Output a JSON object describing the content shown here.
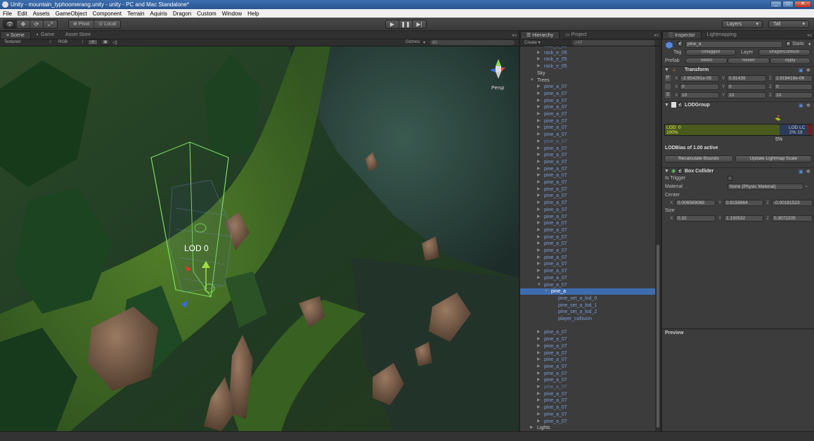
{
  "window": {
    "title": "Unity - mountain_typhoomerang.unity - unity - PC and Mac Standalone*"
  },
  "menu": [
    "File",
    "Edit",
    "Assets",
    "GameObject",
    "Component",
    "Terrain",
    "Aquiris",
    "Dragon",
    "Custom",
    "Window",
    "Help"
  ],
  "toolbar": {
    "pivot": "Pivot",
    "local": "Local",
    "layers": "Layers",
    "layout": "Tall"
  },
  "scene": {
    "tabs": [
      "Scene",
      "Game",
      "Asset Store"
    ],
    "render_mode": "Textured",
    "color_mode": "RGB",
    "gizmos": "Gizmos",
    "search": "All",
    "lod_label": "LOD 0",
    "persp": "Persp"
  },
  "hierarchy": {
    "tabs": [
      "Hierarchy",
      "Project"
    ],
    "create": "Create",
    "search": "All",
    "rows": [
      {
        "name": "rock_e_05",
        "indent": 1,
        "arrow": "▶",
        "style": "prefab"
      },
      {
        "name": "rock_e_05",
        "indent": 1,
        "arrow": "▶",
        "style": "prefab"
      },
      {
        "name": "rock_e_05",
        "indent": 1,
        "arrow": "▶",
        "style": "prefab"
      },
      {
        "name": "rock_e_05",
        "indent": 1,
        "arrow": "▶",
        "style": "prefab"
      },
      {
        "name": "Sky",
        "indent": 0,
        "arrow": "",
        "style": "plain"
      },
      {
        "name": "Trees",
        "indent": 0,
        "arrow": "▼",
        "style": "plain"
      },
      {
        "name": "pine_a_07",
        "indent": 1,
        "arrow": "▶",
        "style": "prefab"
      },
      {
        "name": "pine_a_07",
        "indent": 1,
        "arrow": "▶",
        "style": "prefab"
      },
      {
        "name": "pine_a_07",
        "indent": 1,
        "arrow": "▶",
        "style": "prefab"
      },
      {
        "name": "pine_a_07",
        "indent": 1,
        "arrow": "▶",
        "style": "prefab"
      },
      {
        "name": "pine_a_07",
        "indent": 1,
        "arrow": "▶",
        "style": "prefab"
      },
      {
        "name": "pine_a_07",
        "indent": 1,
        "arrow": "▶",
        "style": "prefab"
      },
      {
        "name": "pine_a_07",
        "indent": 1,
        "arrow": "▶",
        "style": "prefab"
      },
      {
        "name": "pine_a_07",
        "indent": 1,
        "arrow": "▶",
        "style": "prefab"
      },
      {
        "name": "pine_a_07",
        "indent": 1,
        "arrow": "▶",
        "style": "dim"
      },
      {
        "name": "pine_a_07",
        "indent": 1,
        "arrow": "▶",
        "style": "prefab"
      },
      {
        "name": "pine_a_07",
        "indent": 1,
        "arrow": "▶",
        "style": "prefab"
      },
      {
        "name": "pine_a_07",
        "indent": 1,
        "arrow": "▶",
        "style": "prefab"
      },
      {
        "name": "pine_a_07",
        "indent": 1,
        "arrow": "▶",
        "style": "prefab"
      },
      {
        "name": "pine_a_07",
        "indent": 1,
        "arrow": "▶",
        "style": "prefab"
      },
      {
        "name": "pine_a_07",
        "indent": 1,
        "arrow": "▶",
        "style": "prefab"
      },
      {
        "name": "pine_a_07",
        "indent": 1,
        "arrow": "▶",
        "style": "prefab"
      },
      {
        "name": "pine_a_07",
        "indent": 1,
        "arrow": "▶",
        "style": "prefab"
      },
      {
        "name": "pine_a_07",
        "indent": 1,
        "arrow": "▶",
        "style": "prefab"
      },
      {
        "name": "pine_a_07",
        "indent": 1,
        "arrow": "▶",
        "style": "prefab"
      },
      {
        "name": "pine_a_07",
        "indent": 1,
        "arrow": "▶",
        "style": "prefab"
      },
      {
        "name": "pine_a_07",
        "indent": 1,
        "arrow": "▶",
        "style": "prefab"
      },
      {
        "name": "pine_a_07",
        "indent": 1,
        "arrow": "▶",
        "style": "prefab"
      },
      {
        "name": "pine_a_07",
        "indent": 1,
        "arrow": "▶",
        "style": "prefab"
      },
      {
        "name": "pine_a_07",
        "indent": 1,
        "arrow": "▶",
        "style": "prefab"
      },
      {
        "name": "pine_a_07",
        "indent": 1,
        "arrow": "▶",
        "style": "prefab"
      },
      {
        "name": "pine_a_07",
        "indent": 1,
        "arrow": "▶",
        "style": "prefab"
      },
      {
        "name": "pine_a_07",
        "indent": 1,
        "arrow": "▶",
        "style": "prefab"
      },
      {
        "name": "pine_a_07",
        "indent": 1,
        "arrow": "▶",
        "style": "prefab"
      },
      {
        "name": "pine_a_07",
        "indent": 1,
        "arrow": "▶",
        "style": "prefab"
      },
      {
        "name": "pine_a_07",
        "indent": 1,
        "arrow": "▼",
        "style": "prefab"
      },
      {
        "name": "pine_a",
        "indent": 2,
        "arrow": "▼",
        "style": "selected"
      },
      {
        "name": "pine_set_a_lod_0",
        "indent": 3,
        "arrow": "",
        "style": "prefab"
      },
      {
        "name": "pine_set_a_lod_1",
        "indent": 3,
        "arrow": "",
        "style": "prefab"
      },
      {
        "name": "pine_set_a_lod_2",
        "indent": 3,
        "arrow": "",
        "style": "prefab"
      },
      {
        "name": "player_collision",
        "indent": 3,
        "arrow": "",
        "style": "prefab"
      },
      {
        "name": "",
        "indent": 0,
        "arrow": "",
        "style": "plain"
      },
      {
        "name": "pine_a_07",
        "indent": 1,
        "arrow": "▶",
        "style": "prefab"
      },
      {
        "name": "pine_a_07",
        "indent": 1,
        "arrow": "▶",
        "style": "prefab"
      },
      {
        "name": "pine_a_07",
        "indent": 1,
        "arrow": "▶",
        "style": "prefab"
      },
      {
        "name": "pine_a_07",
        "indent": 1,
        "arrow": "▶",
        "style": "prefab"
      },
      {
        "name": "pine_a_07",
        "indent": 1,
        "arrow": "▶",
        "style": "prefab"
      },
      {
        "name": "pine_a_07",
        "indent": 1,
        "arrow": "▶",
        "style": "prefab"
      },
      {
        "name": "pine_a_07",
        "indent": 1,
        "arrow": "▶",
        "style": "prefab"
      },
      {
        "name": "pine_a_07",
        "indent": 1,
        "arrow": "▶",
        "style": "prefab"
      },
      {
        "name": "pine_a_07",
        "indent": 1,
        "arrow": "▶",
        "style": "dim"
      },
      {
        "name": "pine_a_07",
        "indent": 1,
        "arrow": "▶",
        "style": "prefab"
      },
      {
        "name": "pine_a_07",
        "indent": 1,
        "arrow": "▶",
        "style": "prefab"
      },
      {
        "name": "pine_a_07",
        "indent": 1,
        "arrow": "▶",
        "style": "prefab"
      },
      {
        "name": "pine_a_07",
        "indent": 1,
        "arrow": "▶",
        "style": "prefab"
      },
      {
        "name": "pine_a_07",
        "indent": 1,
        "arrow": "▶",
        "style": "prefab"
      },
      {
        "name": "Lights",
        "indent": 0,
        "arrow": "▶",
        "style": "plain"
      },
      {
        "name": "Taming_typhoomerang",
        "indent": 0,
        "arrow": "▶",
        "style": "plain"
      }
    ]
  },
  "inspector": {
    "tabs": [
      "Inspector",
      "Lightmapping"
    ],
    "object_name": "pine_a",
    "static_label": "Static",
    "tag_label": "Tag",
    "tag_value": "Untagged",
    "layer_label": "Layer",
    "layer_value": "DragonCollision",
    "prefab_label": "Prefab",
    "prefab_select": "Select",
    "prefab_revert": "Revert",
    "prefab_apply": "Apply",
    "transform": {
      "title": "Transform",
      "position": {
        "x": "-2.654281e-05",
        "y": "0.91439",
        "z": "2.919419e-06"
      },
      "rotation": {
        "x": "0",
        "y": "0",
        "z": "0"
      },
      "scale": {
        "x": "10",
        "y": "10",
        "z": "10"
      }
    },
    "lodgroup": {
      "title": "LODGroup",
      "lod0_label": "LOD: 0",
      "lod0_pct": "100%",
      "lod1_label": "LOD LC",
      "lod1_pct": "2%  19",
      "marker_pct": "5%",
      "lodbias": "LODBias of 1.00 active",
      "recalc_button": "Recalculate Bounds",
      "update_button": "Update Lightmap Scale"
    },
    "boxcollider": {
      "title": "Box Collider",
      "is_trigger_label": "Is Trigger",
      "material_label": "Material",
      "material_value": "None (Physic Material)",
      "center_label": "Center",
      "center": {
        "x": "0.006569088",
        "y": "0.6158864",
        "z": "-0.00181523"
      },
      "size_label": "Size",
      "size": {
        "x": "0.32",
        "y": "1.130532",
        "z": "0.3072205"
      }
    },
    "preview_label": "Preview"
  },
  "axis_letters": {
    "x": "X",
    "y": "Y",
    "z": "Z"
  }
}
